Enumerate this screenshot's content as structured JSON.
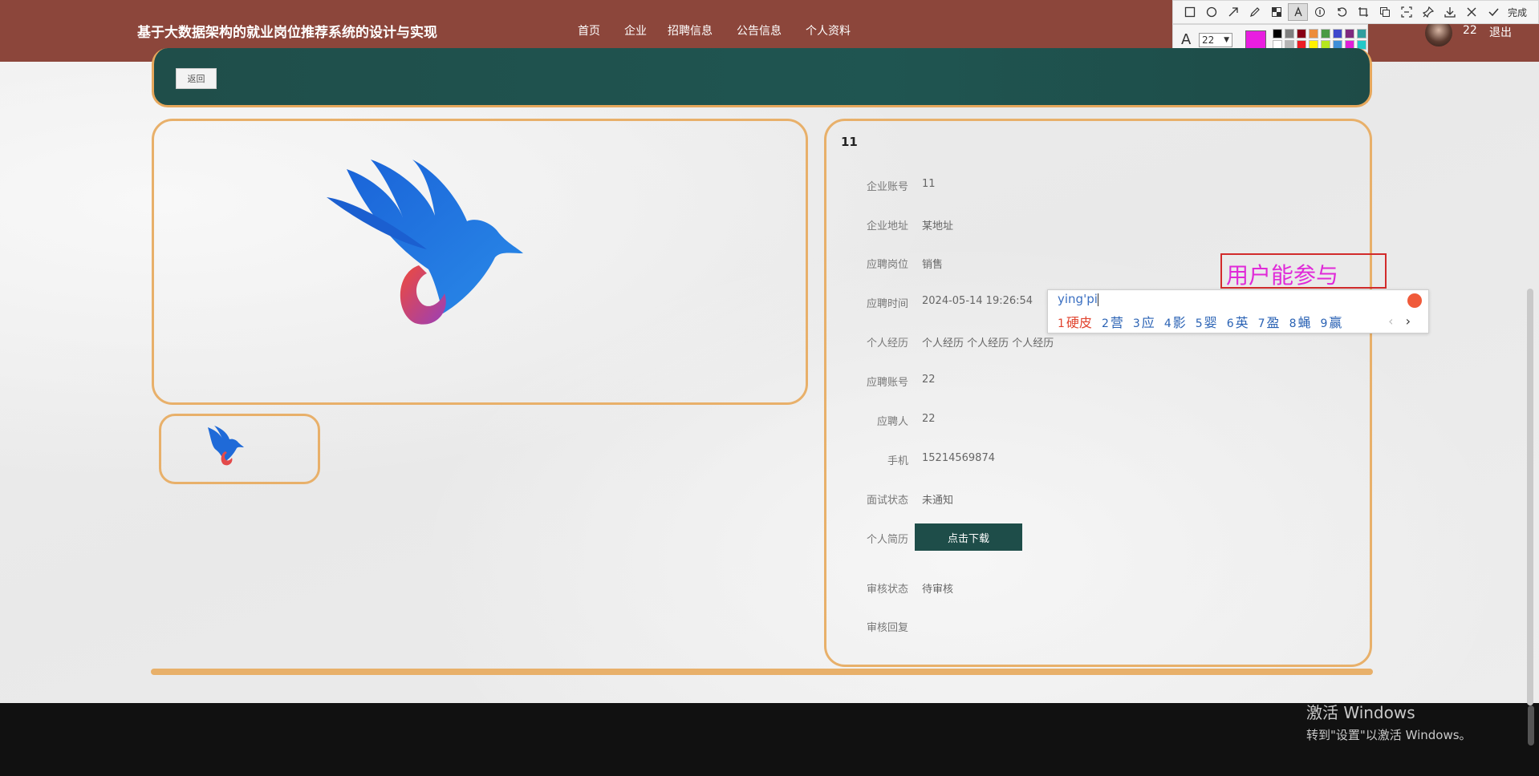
{
  "site_title": "基于大数据架构的就业岗位推荐系统的设计与实现",
  "nav": [
    "首页",
    "企业",
    "招聘信息",
    "公告信息",
    "个人资料"
  ],
  "user": {
    "name": "22",
    "logout": "退出"
  },
  "snap_toolbar": {
    "icons": [
      "rect-tool-icon",
      "ellipse-tool-icon",
      "arrow-tool-icon",
      "pen-tool-icon",
      "mosaic-tool-icon",
      "text-tool-icon",
      "number-tool-icon",
      "undo-icon",
      "crop-icon",
      "copy-icon",
      "ocr-icon",
      "pin-icon",
      "save-icon",
      "close-icon"
    ],
    "done_label": "完成",
    "font_size": "22",
    "current_color": "#e81ee0",
    "palette": [
      "#000000",
      "#7f7f7f",
      "#880015",
      "#ed8c3a",
      "#4a9a44",
      "#3f48cc",
      "#7f297f",
      "#2f9e9e",
      "#ffffff",
      "#b5b5b5",
      "#ed1c24",
      "#fff200",
      "#b5e61d",
      "#3f8fd8",
      "#e01ed8",
      "#23c8c8"
    ]
  },
  "back_label": "返回",
  "detail": {
    "title": "11",
    "rows": [
      {
        "label": "企业账号",
        "value": "11"
      },
      {
        "label": "企业地址",
        "value": "某地址"
      },
      {
        "label": "应聘岗位",
        "value": "销售"
      },
      {
        "label": "应聘时间",
        "value": "2024-05-14 19:26:54"
      },
      {
        "label": "个人经历",
        "value": "个人经历 个人经历 个人经历"
      },
      {
        "label": "应聘账号",
        "value": "22"
      },
      {
        "label": "应聘人",
        "value": "22"
      },
      {
        "label": "手机",
        "value": "15214569874"
      },
      {
        "label": "面试状态",
        "value": "未通知"
      },
      {
        "label": "个人简历",
        "value": ""
      },
      {
        "label": "审核状态",
        "value": "待审核"
      },
      {
        "label": "审核回复",
        "value": ""
      }
    ],
    "download_label": "点击下载"
  },
  "annotation_text": "用户能参与",
  "ime": {
    "composition": "ying'pi",
    "candidates": [
      {
        "n": "1",
        "w": "硬皮"
      },
      {
        "n": "2",
        "w": "营"
      },
      {
        "n": "3",
        "w": "应"
      },
      {
        "n": "4",
        "w": "影"
      },
      {
        "n": "5",
        "w": "婴"
      },
      {
        "n": "6",
        "w": "英"
      },
      {
        "n": "7",
        "w": "盈"
      },
      {
        "n": "8",
        "w": "蝇"
      },
      {
        "n": "9",
        "w": "赢"
      }
    ]
  },
  "windows_activation": {
    "line1": "激活 Windows",
    "line2": "转到\"设置\"以激活 Windows。"
  }
}
